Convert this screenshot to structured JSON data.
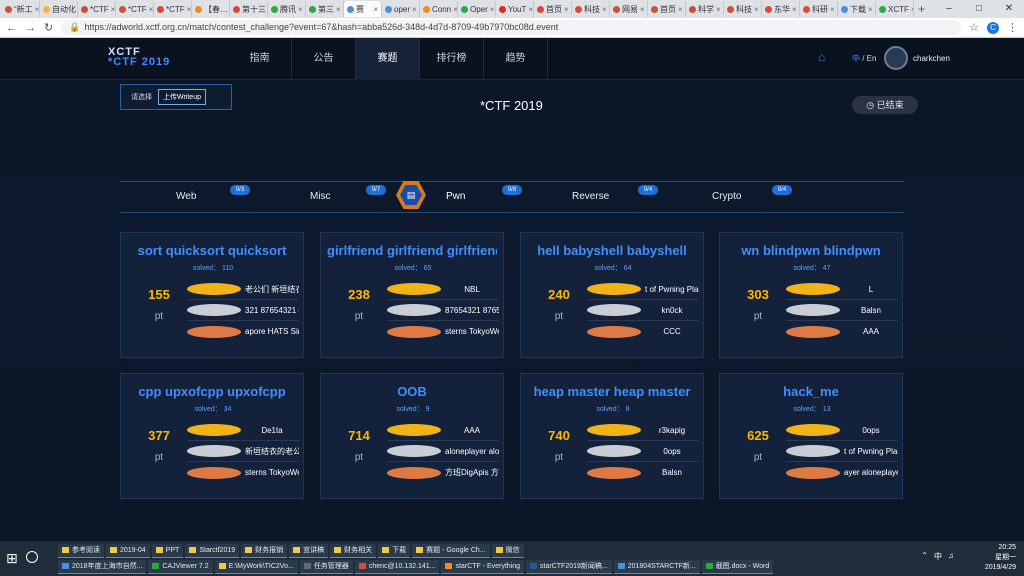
{
  "browser": {
    "tabs": [
      {
        "label": "“新工",
        "color": "#d64a3a"
      },
      {
        "label": "自动化",
        "color": "#f2b632"
      },
      {
        "label": "*CTF",
        "color": "#d64a3a"
      },
      {
        "label": "*CTF",
        "color": "#d64a3a"
      },
      {
        "label": "*CTF",
        "color": "#d64a3a"
      },
      {
        "label": "【春…",
        "color": "#f08b22"
      },
      {
        "label": "第十三",
        "color": "#d64a3a"
      },
      {
        "label": "腾讯",
        "color": "#2aa845"
      },
      {
        "label": "第三",
        "color": "#2aa845"
      },
      {
        "label": "赛",
        "color": "#4a90e2",
        "active": true
      },
      {
        "label": "oper",
        "color": "#4a90e2"
      },
      {
        "label": "Conn",
        "color": "#f08b22"
      },
      {
        "label": "Oper",
        "color": "#2aa845"
      },
      {
        "label": "YouT",
        "color": "#e02b2b"
      },
      {
        "label": "首页",
        "color": "#d64a3a"
      },
      {
        "label": "科技",
        "color": "#d64a3a"
      },
      {
        "label": "网易",
        "color": "#d64a3a"
      },
      {
        "label": "首页",
        "color": "#d64a3a"
      },
      {
        "label": "科学",
        "color": "#d64a3a"
      },
      {
        "label": "科技",
        "color": "#d64a3a"
      },
      {
        "label": "东华",
        "color": "#d64a3a"
      },
      {
        "label": "科研",
        "color": "#d64a3a"
      },
      {
        "label": "下载",
        "color": "#4a90e2"
      },
      {
        "label": "XCTF",
        "color": "#2aa845"
      }
    ],
    "url": "https://adworld.xctf.org.cn/match/contest_challenge?event=67&hash=abba526d-348d-4d7d-8709-49b7970bc08d.event",
    "profile_initial": "C"
  },
  "site": {
    "logo_line1": "XCTF",
    "logo_line2": "*CTF 2019",
    "menu": [
      "指南",
      "公告",
      "赛题",
      "排行榜",
      "趋势"
    ],
    "lang_zh": "中",
    "lang_en": "/ En",
    "username": "charkchen",
    "choose_label": "请选择",
    "upload_writeup": "上传Writeup",
    "contest_title": "*CTF 2019",
    "ended_label": "已结束",
    "categories": [
      {
        "name": "Web",
        "count": "0/3"
      },
      {
        "name": "Misc",
        "count": "0/7"
      },
      {
        "name": "Pwn",
        "count": "0/8"
      },
      {
        "name": "Reverse",
        "count": "0/4"
      },
      {
        "name": "Crypto",
        "count": "0/4"
      }
    ],
    "challenges": [
      {
        "name": "sort  quicksort  quicksort",
        "solved": "solved： 110",
        "points": "155",
        "pt": "pt",
        "ranks": [
          "老公们    新垣结衣的老",
          "321    87654321    87",
          "apore    HATS Singa"
        ]
      },
      {
        "name": "girlfriend  girlfriend  girlfriend",
        "solved": "solved： 65",
        "points": "238",
        "pt": "pt",
        "ranks": [
          "NBL",
          "87654321    8765432",
          "sterns    TokyoWester"
        ]
      },
      {
        "name": "hell  babyshell  babyshell",
        "solved": "solved： 64",
        "points": "240",
        "pt": "pt",
        "ranks": [
          "t of Pwning    Plaid Pa",
          "kn0ck",
          "CCC"
        ]
      },
      {
        "name": "wn  blindpwn  blindpwn",
        "solved": "solved： 47",
        "points": "303",
        "pt": "pt",
        "ranks": [
          "L",
          "Balsn",
          "AAA"
        ]
      },
      {
        "name": "cpp  upxofcpp  upxofcpp",
        "solved": "solved： 34",
        "points": "377",
        "pt": "pt",
        "ranks": [
          "De1ta",
          "新垣结衣的老公们",
          "sterns    TokyoWester"
        ]
      },
      {
        "name": "OOB",
        "solved": "solved： 9",
        "points": "714",
        "pt": "pt",
        "ranks": [
          "AAA",
          "aloneplayer    alonep",
          "方班DigApis    方班D"
        ]
      },
      {
        "name": "heap master  heap master",
        "solved": "solved： 8",
        "points": "740",
        "pt": "pt",
        "ranks": [
          "r3kapig",
          "0ops",
          "Balsn"
        ]
      },
      {
        "name": "hack_me",
        "solved": "solved： 13",
        "points": "625",
        "pt": "pt",
        "ranks": [
          "0ops",
          "t of Pwning    Plaid Pa",
          "ayer    aloneplayer"
        ]
      }
    ]
  },
  "taskbar": {
    "row1": [
      "参考阅读",
      "2019-04",
      "PPT",
      "Starctf2019",
      "财务报销",
      "宣讲稿",
      "财务相关",
      "下载",
      "赛题 - Google Ch...",
      "微信"
    ],
    "row2": [
      "2018年度上海市自然...",
      "CAJViewer 7.2",
      "E:\\MyWork\\TIC2Vo...",
      "任务管理器",
      "chenc@10.132.141...",
      "starCTF - Everything",
      "starCTF2019新闻稿...",
      "201804STARCTF新...",
      "截图.docx - Word"
    ],
    "time": "20:25",
    "weekday": "星期一",
    "date": "2019/4/29",
    "ime": "中"
  }
}
